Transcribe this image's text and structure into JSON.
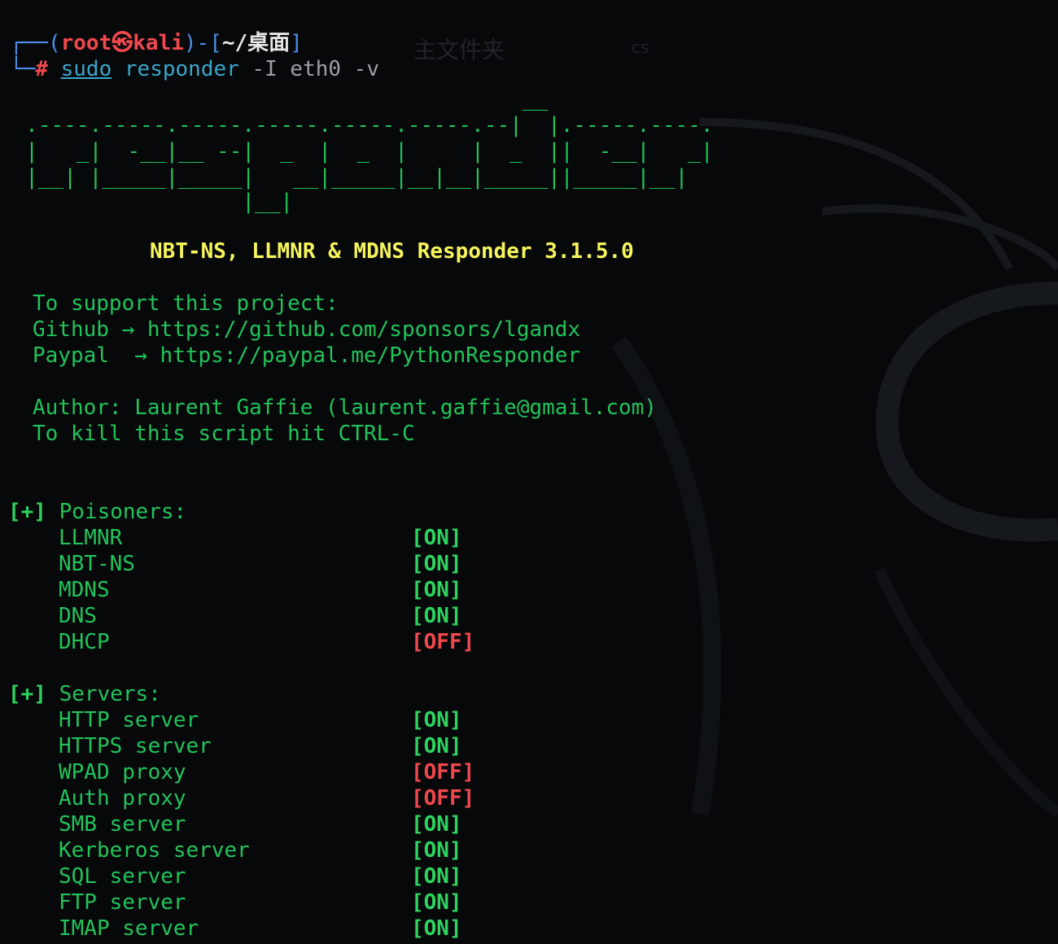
{
  "desktop": {
    "labels": [
      "主文件夹",
      "cs"
    ]
  },
  "prompt": {
    "user": "root",
    "host": "kali",
    "cwd": "~/桌面",
    "command": {
      "sudo": "sudo",
      "program": "responder",
      "args": "-I eth0 -v"
    }
  },
  "banner": {
    "ascii": [
      "                                         __",
      "  .----.-----.-----.-----.-----.-----.--|  |.-----.----.",
      "  |   _|  -__|__ --|  _  |  _  |     |  _  ||  -__|   _|",
      "  |__| |_____|_____|   __|_____|__|__|_____||_____|__|",
      "                   |__|"
    ],
    "title": "NBT-NS, LLMNR & MDNS Responder 3.1.5.0"
  },
  "support": {
    "heading": "To support this project:",
    "github_label": "Github",
    "github_url": "https://github.com/sponsors/lgandx",
    "paypal_label": "Paypal",
    "paypal_url": "https://paypal.me/PythonResponder",
    "arrow": "→"
  },
  "author": {
    "line": "Author: Laurent Gaffie (laurent.gaffie@gmail.com)",
    "kill": "To kill this script hit CTRL-C"
  },
  "sections": [
    {
      "marker": "[+]",
      "title": "Poisoners:",
      "items": [
        {
          "name": "LLMNR",
          "status": "[ON]"
        },
        {
          "name": "NBT-NS",
          "status": "[ON]"
        },
        {
          "name": "MDNS",
          "status": "[ON]"
        },
        {
          "name": "DNS",
          "status": "[ON]"
        },
        {
          "name": "DHCP",
          "status": "[OFF]"
        }
      ]
    },
    {
      "marker": "[+]",
      "title": "Servers:",
      "items": [
        {
          "name": "HTTP server",
          "status": "[ON]"
        },
        {
          "name": "HTTPS server",
          "status": "[ON]"
        },
        {
          "name": "WPAD proxy",
          "status": "[OFF]"
        },
        {
          "name": "Auth proxy",
          "status": "[OFF]"
        },
        {
          "name": "SMB server",
          "status": "[ON]"
        },
        {
          "name": "Kerberos server",
          "status": "[ON]"
        },
        {
          "name": "SQL server",
          "status": "[ON]"
        },
        {
          "name": "FTP server",
          "status": "[ON]"
        },
        {
          "name": "IMAP server",
          "status": "[ON]"
        }
      ]
    }
  ],
  "colors": {
    "on": "#2ed35f",
    "off": "#f0484d",
    "title": "#f6f55c",
    "text": "#22c35a"
  }
}
